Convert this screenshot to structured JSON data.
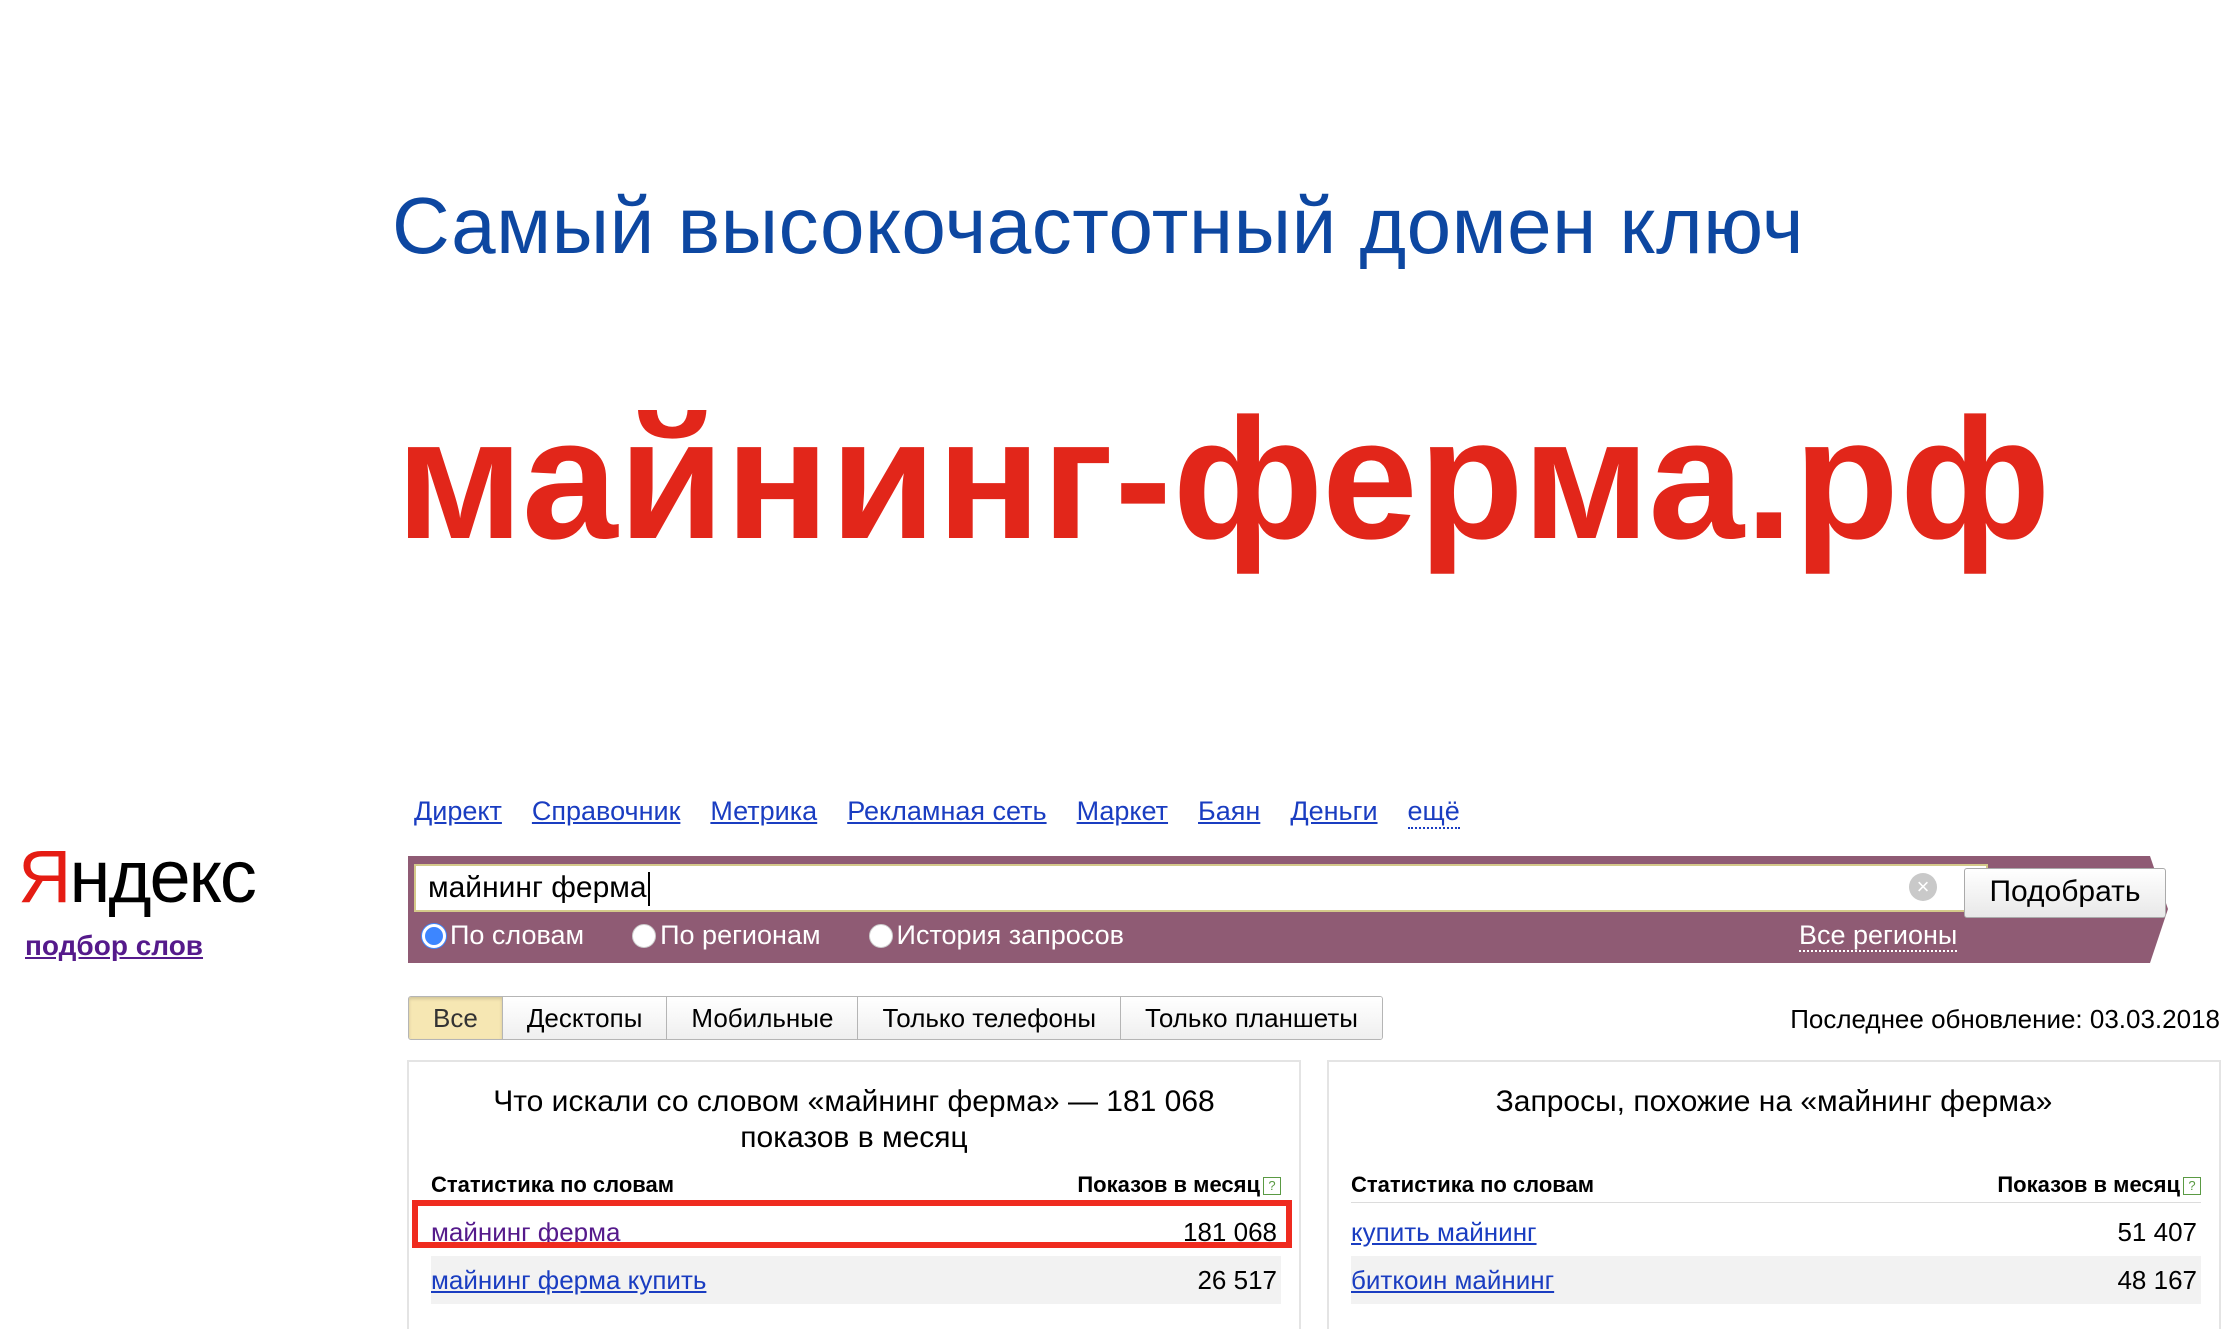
{
  "headline": "Самый высокочастотный домен ключ",
  "domain": "майнинг-ферма.рф",
  "logo": {
    "ya": "Я",
    "rest": "ндекс",
    "subtitle": "подбор слов",
    "brand_color": "#e51c13"
  },
  "nav_links": [
    "Директ",
    "Справочник",
    "Метрика",
    "Рекламная сеть",
    "Маркет",
    "Баян",
    "Деньги",
    "ещё"
  ],
  "search": {
    "value": "майнинг ферма",
    "submit_label": "Подобрать",
    "bar_color": "#8f5b74",
    "modes": [
      {
        "label": "По словам",
        "selected": true
      },
      {
        "label": "По регионам",
        "selected": false
      },
      {
        "label": "История запросов",
        "selected": false
      }
    ],
    "regions_link": "Все регионы"
  },
  "device_tabs": [
    {
      "label": "Все",
      "active": true
    },
    {
      "label": "Десктопы",
      "active": false
    },
    {
      "label": "Мобильные",
      "active": false
    },
    {
      "label": "Только телефоны",
      "active": false
    },
    {
      "label": "Только планшеты",
      "active": false
    }
  ],
  "last_update": "Последнее обновление: 03.03.2018",
  "left_panel": {
    "title_line1": "Что искали со словом «майнинг ферма» — 181 068",
    "title_line2": "показов в месяц",
    "col1": "Статистика по словам",
    "col2": "Показов в месяц",
    "rows": [
      {
        "phrase": "майнинг ферма",
        "count": "181 068"
      },
      {
        "phrase": "майнинг ферма купить",
        "count": "26 517"
      }
    ]
  },
  "right_panel": {
    "title": "Запросы, похожие на «майнинг ферма»",
    "col1": "Статистика по словам",
    "col2": "Показов в месяц",
    "rows": [
      {
        "phrase": "купить майнинг",
        "count": "51 407"
      },
      {
        "phrase": "биткоин майнинг",
        "count": "48 167"
      }
    ]
  },
  "help_glyph": "?"
}
